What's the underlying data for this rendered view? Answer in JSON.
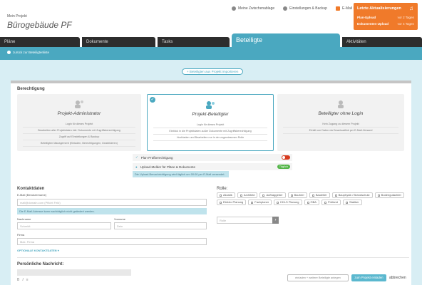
{
  "header": {
    "breadcrumb": "Mein Projekt",
    "title": "Bürogebäude PF",
    "links": [
      {
        "label": "Meine Zwischenablage",
        "icon": "user-icon"
      },
      {
        "label": "Einstellungen & Backup",
        "icon": "gear-icon"
      },
      {
        "label": "E-Mail Melder",
        "icon": "mail-icon"
      }
    ],
    "notifications": {
      "title": "Letzte Aktualisierungen",
      "rows": [
        {
          "label": "Plan-Upload",
          "time": "vor 2 Tagen"
        },
        {
          "label": "Dokumenten-Upload",
          "time": "vor 4 Tagen"
        }
      ]
    }
  },
  "tabs": [
    {
      "label": "Pläne"
    },
    {
      "label": "Dokumente"
    },
    {
      "label": "Tasks"
    },
    {
      "label": "Beteiligte"
    },
    {
      "label": "Aktivitäten"
    }
  ],
  "back_link": "zurück zur Beteiligtenliste",
  "import_button": "+ Beteiligten aus Projekt importieren",
  "permissions": {
    "label": "Berechtigung",
    "roles": [
      {
        "title": "Projekt-Administrator",
        "lines": [
          "Login für dieses Projekt",
          "Bearbeiten aller Projektdaten inkl. Dokumente mit Zugriffsberechtigung",
          "Zugriff auf Einstellungen & Backup",
          "Beteiligten Management (Einladen, Berechtigungen, Deaktivieren)"
        ]
      },
      {
        "title": "Projekt-Beteiligter",
        "lines": [
          "Login für dieses Projekt",
          "Einblick in die Projektdaten außer Dokumente mit Zugriffsberechtigung",
          "Hochladen und Bearbeiten nur in der zugewiesenen Rolle"
        ]
      },
      {
        "title": "Beteiligter ohne Login",
        "lines": [
          "Kein Zugang zu diesem Projekt",
          "Erhält von Daten via Downloadlink per E-Mail-Versand"
        ]
      }
    ],
    "options": [
      {
        "label": "Plan-Prüfberechtigung",
        "state": "off"
      },
      {
        "label": "Upload-Melder für Pläne & Dokumente",
        "badge": "Täglich"
      }
    ],
    "note": "Die Upload-Benachrichtigung wird täglich um 00:00 per E-Mail versendet."
  },
  "contact": {
    "label": "Kontaktdaten",
    "email_label": "E-Mail (Benutzername)",
    "email_placeholder": "mail@domain.com (Pflicht Feld)",
    "hint": "Die E-Mail-Adresse kann nachträglich nicht geändert werden.",
    "lastname_label": "Nachname",
    "lastname_placeholder": "Schmidt",
    "firstname_label": "Vorname",
    "firstname_placeholder": "Dein",
    "company_label": "Firma",
    "company_placeholder": "Max. Firma",
    "more_link": "OPTIONALE KONTAKTDATEN"
  },
  "roles": {
    "label": "Rolle:",
    "chips": [
      "Akustik",
      "Architekt",
      "Auftraggeber",
      "Bauherr",
      "Bauleiter",
      "Bauphysik / Brandschutz",
      "Bodengutachter",
      "Elektro Planung",
      "Fachplaner",
      "HKLS Planung",
      "ÖBA",
      "Prüfamt",
      "Statiker"
    ],
    "select_placeholder": "Rolle"
  },
  "message": {
    "label": "Persönliche Nachricht:"
  },
  "footer": {
    "secondary": "einladen + weitere Beteiligte anlegen",
    "primary": "zum Projekt einladen",
    "cancel": "abbrechen"
  }
}
